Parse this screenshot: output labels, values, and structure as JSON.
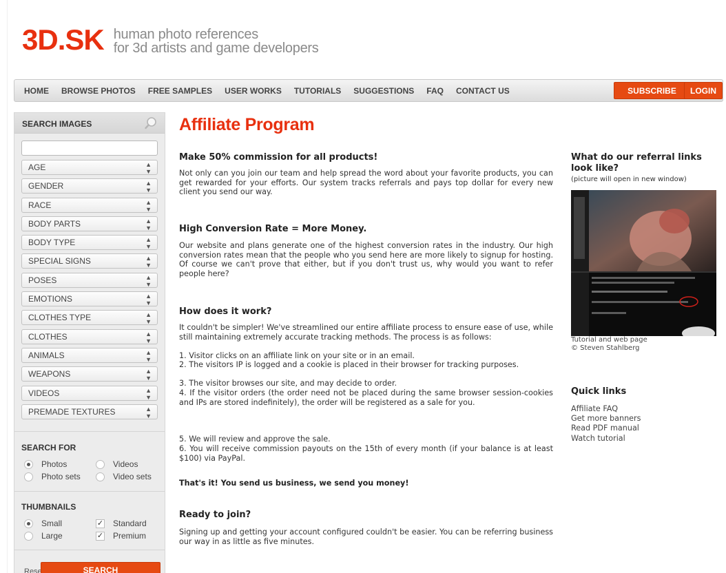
{
  "header": {
    "logo": "3D.SK",
    "tagline_line1": "human photo references",
    "tagline_line2": "for 3d artists and game developers"
  },
  "nav": {
    "items": [
      "HOME",
      "BROWSE PHOTOS",
      "FREE SAMPLES",
      "USER WORKS",
      "TUTORIALS",
      "SUGGESTIONS",
      "FAQ",
      "CONTACT US"
    ],
    "subscribe": "SUBSCRIBE",
    "login": "LOGIN"
  },
  "sidebar": {
    "title": "SEARCH IMAGES",
    "search_value": "",
    "filters": [
      "AGE",
      "GENDER",
      "RACE",
      "BODY PARTS",
      "BODY TYPE",
      "SPECIAL SIGNS",
      "POSES",
      "EMOTIONS",
      "CLOTHES TYPE",
      "CLOTHES",
      "ANIMALS",
      "WEAPONS",
      "VIDEOS",
      "PREMADE TEXTURES"
    ],
    "search_for": {
      "title": "SEARCH FOR",
      "photos": "Photos",
      "videos": "Videos",
      "photo_sets": "Photo sets",
      "video_sets": "Video sets"
    },
    "thumbnails": {
      "title": "THUMBNAILS",
      "small": "Small",
      "large": "Large",
      "standard": "Standard",
      "premium": "Premium"
    },
    "reset": "Reset",
    "search_button": "SEARCH"
  },
  "main": {
    "title": "Affiliate Program",
    "s1_heading": "Make 50% commission for all products!",
    "s1_body": "Not only can you join our team and help spread the word about your favorite products, you can get rewarded for your efforts. Our system tracks referrals and pays top dollar for every new client you send our way.",
    "s2_heading": "High Conversion Rate = More Money.",
    "s2_body": "Our website and plans generate one of the highest conversion rates in the industry. Our high conversion rates mean that the people who you send here are more likely to signup for hosting. Of course we can't prove that either, but if you don't trust us, why would you want to refer people here?",
    "s3_heading": "How does it work?",
    "s3_intro": "It couldn't be simpler! We've streamlined our entire affiliate process to ensure ease of use, while still maintaining extremely accurate tracking methods. The process is as follows:",
    "s3_step1": "1. Visitor clicks on an affiliate link on your site or in an email.",
    "s3_step2": "2. The visitors IP is logged and a cookie is placed in their browser for tracking purposes.",
    "s3_step3": "3. The visitor browses our site, and may decide to order.",
    "s3_step4": "4. If the visitor orders (the order need not be placed during the same browser session-cookies and IPs are stored indefinitely), the order will be registered as a sale for you.",
    "s3_step5": "5. We will review and approve the sale.",
    "s3_step6": "6. You will receive commission payouts on the 15th of every month (if your balance is at least $100) via PayPal.",
    "tagline": "That's it! You send us business, we send you money!",
    "s4_heading": "Ready to join?",
    "s4_body": "Signing up and getting your account configured couldn't be easier. You can be referring business our way in as little as five minutes."
  },
  "right": {
    "heading": "What do our referral links look like?",
    "note": "(picture will open in new window)",
    "caption_line1": "Tutorial and web page",
    "caption_line2": "© Steven Stahlberg",
    "quick_links_title": "Quick links",
    "quick_links": [
      "Affiliate FAQ",
      "Get more banners",
      "Read PDF manual",
      "Watch tutorial"
    ]
  }
}
